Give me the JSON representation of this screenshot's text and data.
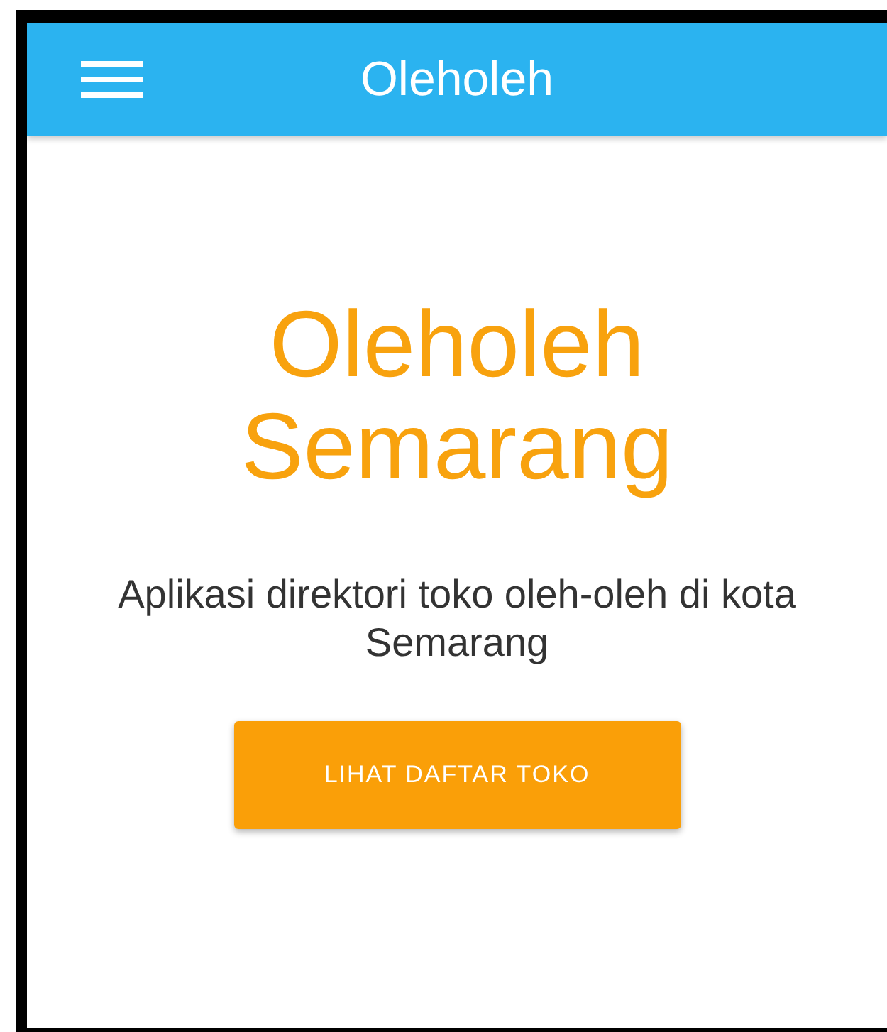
{
  "app_bar": {
    "title": "Oleholeh"
  },
  "hero": {
    "title": "Oleholeh Semarang",
    "subtitle": "Aplikasi direktori toko oleh-oleh di kota Semarang",
    "button": "LIHAT DAFTAR TOKO"
  }
}
